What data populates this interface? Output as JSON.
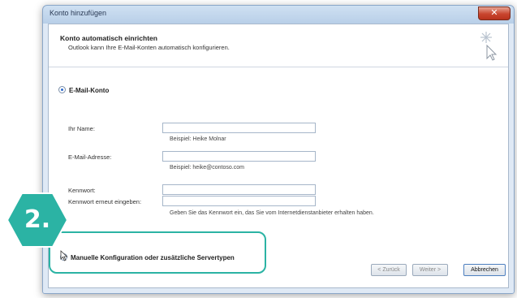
{
  "window": {
    "title": "Konto hinzufügen",
    "close_glyph": "✕"
  },
  "header": {
    "title": "Konto automatisch einrichten",
    "subtitle": "Outlook kann Ihre E-Mail-Konten automatisch konfigurieren."
  },
  "email_account": {
    "radio_label": "E-Mail-Konto",
    "selected": true
  },
  "form": {
    "name_label": "Ihr Name:",
    "name_value": "",
    "name_hint": "Beispiel: Heike Molnar",
    "email_label": "E-Mail-Adresse:",
    "email_value": "",
    "email_hint": "Beispiel: heike@contoso.com",
    "password_label": "Kennwort:",
    "password_value": "",
    "password_repeat_label": "Kennwort erneut eingeben:",
    "password_repeat_value": "",
    "password_hint": "Geben Sie das Kennwort ein, das Sie vom Internetdienstanbieter erhalten haben."
  },
  "manual": {
    "radio_label": "Manuelle Konfiguration oder zusätzliche Servertypen",
    "selected": false
  },
  "buttons": {
    "back": "< Zurück",
    "next": "Weiter >",
    "cancel": "Abbrechen"
  },
  "badge": {
    "text": "2.",
    "color": "#2bb3a4"
  },
  "icons": {
    "setup": "wand-sparkle-icon",
    "cursor": "mouse-pointer-icon"
  }
}
